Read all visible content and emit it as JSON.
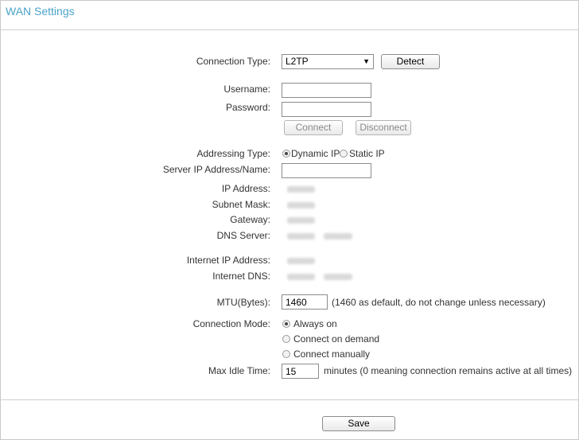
{
  "header": {
    "title": "WAN Settings"
  },
  "form": {
    "connection_type": {
      "label": "Connection Type:",
      "value": "L2TP",
      "detect_label": "Detect"
    },
    "username": {
      "label": "Username:",
      "value": ""
    },
    "password": {
      "label": "Password:",
      "value": ""
    },
    "connect_label": "Connect",
    "disconnect_label": "Disconnect",
    "addressing_type": {
      "label": "Addressing Type:",
      "options": [
        "Dynamic IP",
        "Static IP"
      ],
      "selected": "Dynamic IP"
    },
    "server": {
      "label": "Server IP Address/Name:",
      "value": ""
    },
    "ip_address_label": "IP Address:",
    "subnet_mask_label": "Subnet Mask:",
    "gateway_label": "Gateway:",
    "dns_server_label": "DNS Server:",
    "internet_ip_label": "Internet IP Address:",
    "internet_dns_label": "Internet DNS:",
    "mtu": {
      "label": "MTU(Bytes):",
      "value": "1460",
      "note": "(1460 as default, do not change unless necessary)"
    },
    "connection_mode": {
      "label": "Connection Mode:",
      "options": [
        "Always on",
        "Connect on demand",
        "Connect manually"
      ],
      "selected": "Always on"
    },
    "max_idle": {
      "label": "Max Idle Time:",
      "value": "15",
      "note": "minutes (0 meaning connection remains active at all times)"
    }
  },
  "footer": {
    "save_label": "Save"
  }
}
